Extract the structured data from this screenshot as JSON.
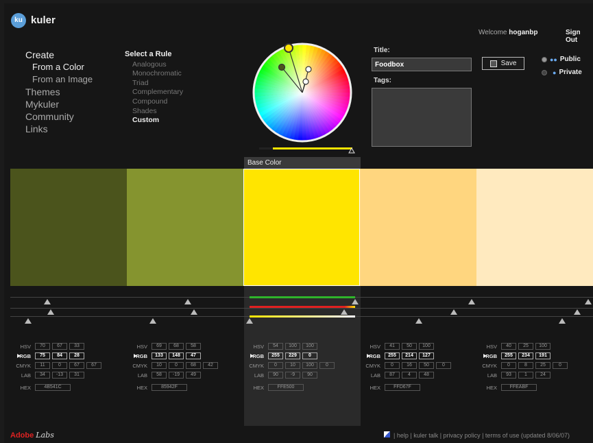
{
  "header": {
    "logo_text": "ku",
    "brand": "kuler",
    "welcome_prefix": "Welcome",
    "username": "hoganbp",
    "sign_out": "Sign Out"
  },
  "nav": {
    "create": "Create",
    "from_color": "From a Color",
    "from_image": "From an Image",
    "themes": "Themes",
    "mykuler": "Mykuler",
    "community": "Community",
    "links": "Links"
  },
  "rules": {
    "heading": "Select a Rule",
    "items": [
      "Analogous",
      "Monochromatic",
      "Triad",
      "Complementary",
      "Compound",
      "Shades",
      "Custom"
    ],
    "active": "Custom"
  },
  "form": {
    "title_label": "Title:",
    "title_value": "Foodbox",
    "tags_label": "Tags:",
    "save_label": "Save",
    "public_label": "Public",
    "private_label": "Private"
  },
  "base_color_label": "Base Color",
  "swatches": [
    {
      "hex_color": "#4B541C",
      "hsv": [
        "70",
        "67",
        "33"
      ],
      "rgb": [
        "75",
        "84",
        "28"
      ],
      "cmyk": [
        "11",
        "0",
        "67",
        "67"
      ],
      "lab": [
        "34",
        "-13",
        "31"
      ],
      "hex": "4B541C"
    },
    {
      "hex_color": "#85942F",
      "hsv": [
        "69",
        "68",
        "58"
      ],
      "rgb": [
        "133",
        "148",
        "47"
      ],
      "cmyk": [
        "10",
        "0",
        "68",
        "42"
      ],
      "lab": [
        "58",
        "-19",
        "49"
      ],
      "hex": "85942F"
    },
    {
      "hex_color": "#FFE500",
      "hsv": [
        "54",
        "100",
        "100"
      ],
      "rgb": [
        "255",
        "229",
        "0"
      ],
      "cmyk": [
        "0",
        "10",
        "100",
        "0"
      ],
      "lab": [
        "90",
        "-9",
        "90"
      ],
      "hex": "FFE500"
    },
    {
      "hex_color": "#FFD67F",
      "hsv": [
        "41",
        "50",
        "100"
      ],
      "rgb": [
        "255",
        "214",
        "127"
      ],
      "cmyk": [
        "0",
        "16",
        "50",
        "0"
      ],
      "lab": [
        "87",
        "4",
        "48"
      ],
      "hex": "FFD67F"
    },
    {
      "hex_color": "#FFEABF",
      "hsv": [
        "40",
        "25",
        "100"
      ],
      "rgb": [
        "255",
        "234",
        "191"
      ],
      "cmyk": [
        "0",
        "8",
        "25",
        "0"
      ],
      "lab": [
        "93",
        "1",
        "24"
      ],
      "hex": "FFEABF"
    }
  ],
  "value_labels": {
    "hsv": "HSV",
    "rgb": "RGB",
    "cmyk": "CMYK",
    "lab": "LAB",
    "hex": "HEX"
  },
  "footer": {
    "adobe": "Adobe",
    "labs": "Labs",
    "links": "|  help  |  kuler talk  |  privacy policy  |  terms of use (updated 8/06/07)"
  },
  "colors": {
    "accent": "#FFE500",
    "background": "#161616"
  }
}
